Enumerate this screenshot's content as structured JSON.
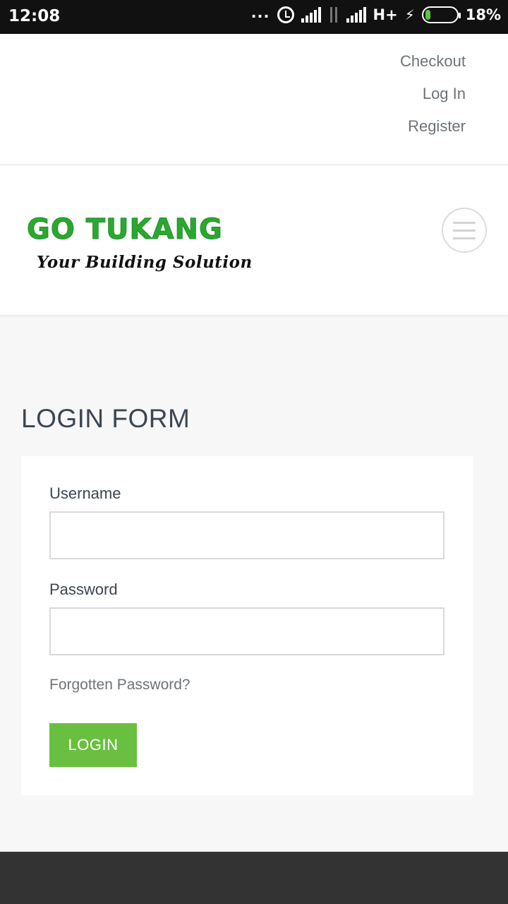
{
  "status_bar": {
    "time": "12:08",
    "dots": "...",
    "network_type": "H+",
    "battery_percent": "18%",
    "battery_level": 0.18,
    "icons": [
      "alarm-icon",
      "signal-icon",
      "data-arrows-icon",
      "signal-icon",
      "charging-icon",
      "battery-icon"
    ]
  },
  "top_links": {
    "items": [
      {
        "label": "Checkout"
      },
      {
        "label": "Log In"
      },
      {
        "label": "Register"
      }
    ]
  },
  "header": {
    "logo_title": "GO TUKANG",
    "logo_tagline": "Your Building Solution",
    "logo_color": "#2aa830",
    "menu_icon": "hamburger-menu-icon"
  },
  "main": {
    "title": "LOGIN FORM",
    "username_label": "Username",
    "username_value": "",
    "password_label": "Password",
    "password_value": "",
    "forgot_link": "Forgotten Password?",
    "login_button": "LOGIN",
    "button_color": "#69bf3f"
  }
}
